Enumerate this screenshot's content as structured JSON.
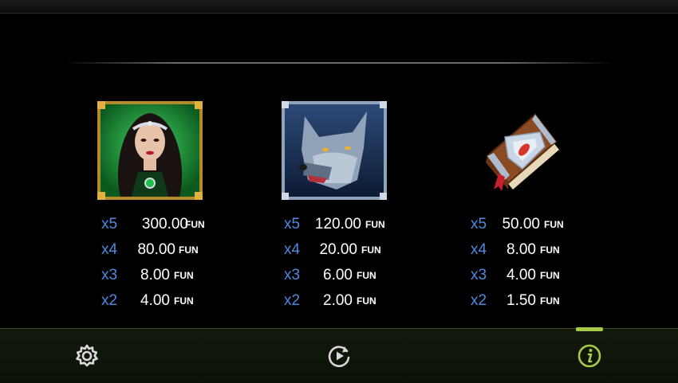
{
  "paytable": {
    "currency": "FUN",
    "symbols": [
      {
        "name": "Sorceress",
        "icon": "sorceress-symbol-icon",
        "pays": [
          {
            "mult": "x5",
            "amount": "300.00"
          },
          {
            "mult": "x4",
            "amount": "80.00"
          },
          {
            "mult": "x3",
            "amount": "8.00"
          },
          {
            "mult": "x2",
            "amount": "4.00"
          }
        ]
      },
      {
        "name": "Wolf",
        "icon": "wolf-symbol-icon",
        "pays": [
          {
            "mult": "x5",
            "amount": "120.00"
          },
          {
            "mult": "x4",
            "amount": "20.00"
          },
          {
            "mult": "x3",
            "amount": "6.00"
          },
          {
            "mult": "x2",
            "amount": "2.00"
          }
        ]
      },
      {
        "name": "Spell Book",
        "icon": "spellbook-symbol-icon",
        "pays": [
          {
            "mult": "x5",
            "amount": "50.00"
          },
          {
            "mult": "x4",
            "amount": "8.00"
          },
          {
            "mult": "x3",
            "amount": "4.00"
          },
          {
            "mult": "x2",
            "amount": "1.50"
          }
        ]
      }
    ]
  },
  "bottom_bar": {
    "items": [
      {
        "icon": "gear-icon",
        "label": ""
      },
      {
        "icon": "replay-icon",
        "label": ""
      },
      {
        "icon": "info-icon",
        "label": "",
        "active": true
      }
    ]
  },
  "colors": {
    "multiplier": "#4d8ae0",
    "active_accent": "#a7c94a",
    "icon_default": "#d8d8d8"
  }
}
